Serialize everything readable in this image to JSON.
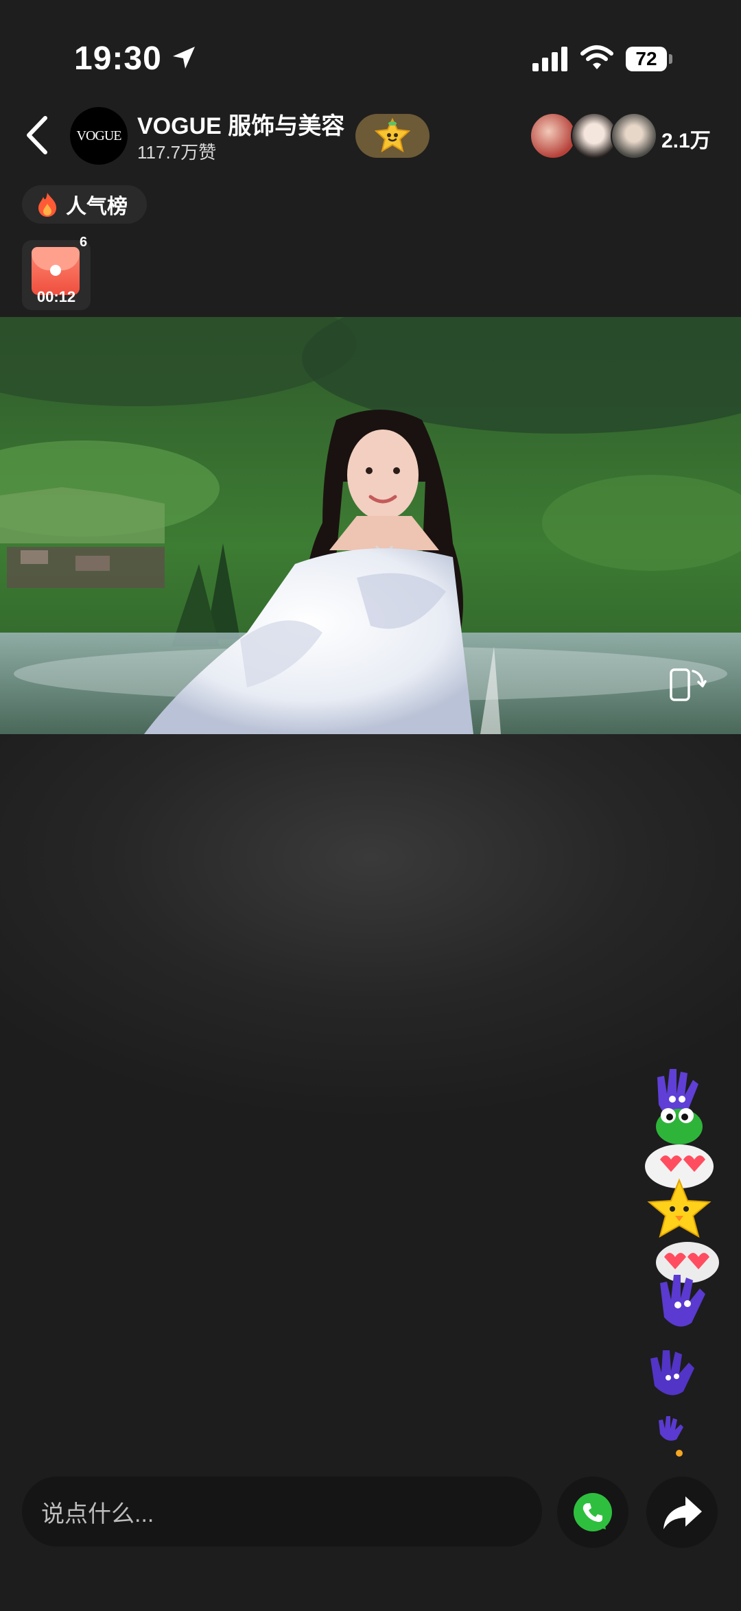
{
  "status_bar": {
    "time": "19:30",
    "battery": "72"
  },
  "header": {
    "avatar_text": "VOGUE",
    "channel_name": "VOGUE 服饰与美容",
    "likes": "117.7万赞",
    "viewer_count": "2.1万"
  },
  "chips": {
    "rank_label": "人气榜",
    "redpack_timer": "00:12",
    "redpack_count": "6"
  },
  "bottom_bar": {
    "input_placeholder": "说点什么..."
  },
  "icons": {
    "back": "back-icon",
    "location": "location-arrow-icon",
    "signal": "signal-icon",
    "wifi": "wifi-icon",
    "battery": "battery-icon",
    "follow": "star-mascot-icon",
    "flame": "flame-icon",
    "redpack": "red-envelope-icon",
    "rotate": "rotate-screen-icon",
    "call": "phone-call-icon",
    "share": "share-arrow-icon"
  },
  "colors": {
    "background": "#1e1e1e",
    "follow_button": "#6d5a37",
    "red_envelope": "#ef4e3d",
    "call_green": "#2fbf3f"
  }
}
